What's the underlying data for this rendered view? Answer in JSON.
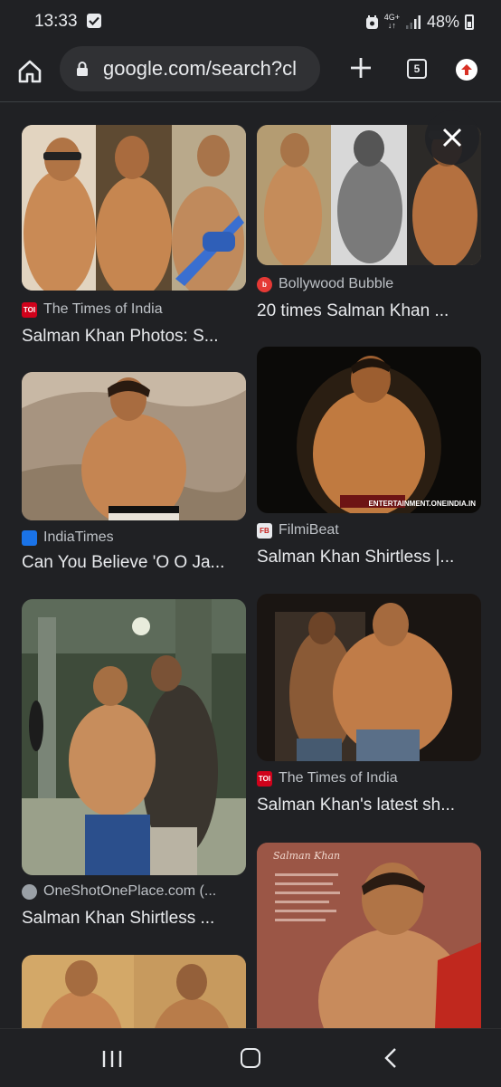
{
  "status_bar": {
    "time": "13:33",
    "network_top": "4G+",
    "network_bottom": "↓↑",
    "battery": "48%"
  },
  "browser": {
    "url": "google.com/search?cl",
    "tab_count": "5"
  },
  "results": [
    {
      "source": "The Times of India",
      "favicon_text": "TOI",
      "favicon_color": "#d0021b",
      "title": "Salman Khan Photos: S..."
    },
    {
      "source": "Bollywood Bubble",
      "favicon_text": "b",
      "favicon_color": "#e53935",
      "title": "20 times Salman Khan ..."
    },
    {
      "source": "IndiaTimes",
      "favicon_text": "",
      "favicon_color": "#1a73e8",
      "title": "Can You Believe 'O O Ja..."
    },
    {
      "source": "FilmiBeat",
      "favicon_text": "FB",
      "favicon_color": "#e8eaed",
      "title": "Salman Khan Shirtless |..."
    },
    {
      "source": "OneShotOnePlace.com (...",
      "favicon_text": "",
      "favicon_color": "#9aa0a6",
      "title": "Salman Khan Shirtless ..."
    },
    {
      "source": "The Times of India",
      "favicon_text": "TOI",
      "favicon_color": "#d0021b",
      "title": "Salman Khan's latest sh..."
    }
  ],
  "image_overlays": {
    "watermark_entertainment": "ENTERTAINMENT.ONEINDIA.IN",
    "signature_magazine": "Salman Khan"
  }
}
